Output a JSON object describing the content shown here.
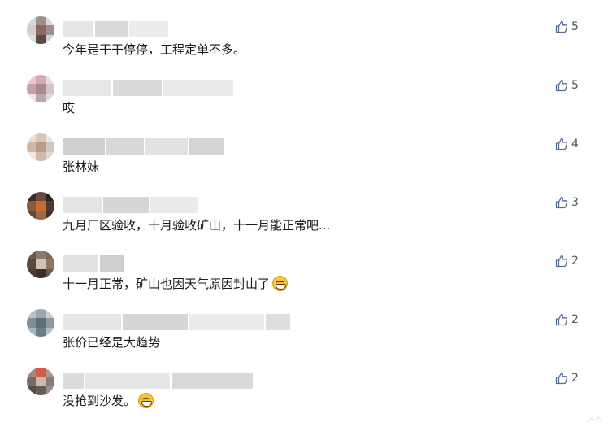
{
  "comments": [
    {
      "text": "今年是干干停停，工程定单不多。",
      "likes": "5"
    },
    {
      "text": "哎",
      "likes": "5"
    },
    {
      "text": "张林妹",
      "likes": "4"
    },
    {
      "text": "九月厂区验收，十月验收矿山，十一月能正常吧...",
      "likes": "3"
    },
    {
      "text": "十一月正常，矿山也因天气原因封山了",
      "likes": "2",
      "emoji": "grin-emoji"
    },
    {
      "text": "张价已经是大趋势",
      "likes": "2"
    },
    {
      "text": "没抢到沙发。",
      "likes": "2",
      "emoji": "grin-emoji"
    }
  ],
  "icons": {
    "like": "thumbs-up-icon",
    "avatar": "avatar-pixelated"
  },
  "colors": {
    "text": "#1a1a1a",
    "like_icon": "#576b95",
    "like_count": "#555555",
    "blur_placeholder": "#d9d9d9"
  }
}
